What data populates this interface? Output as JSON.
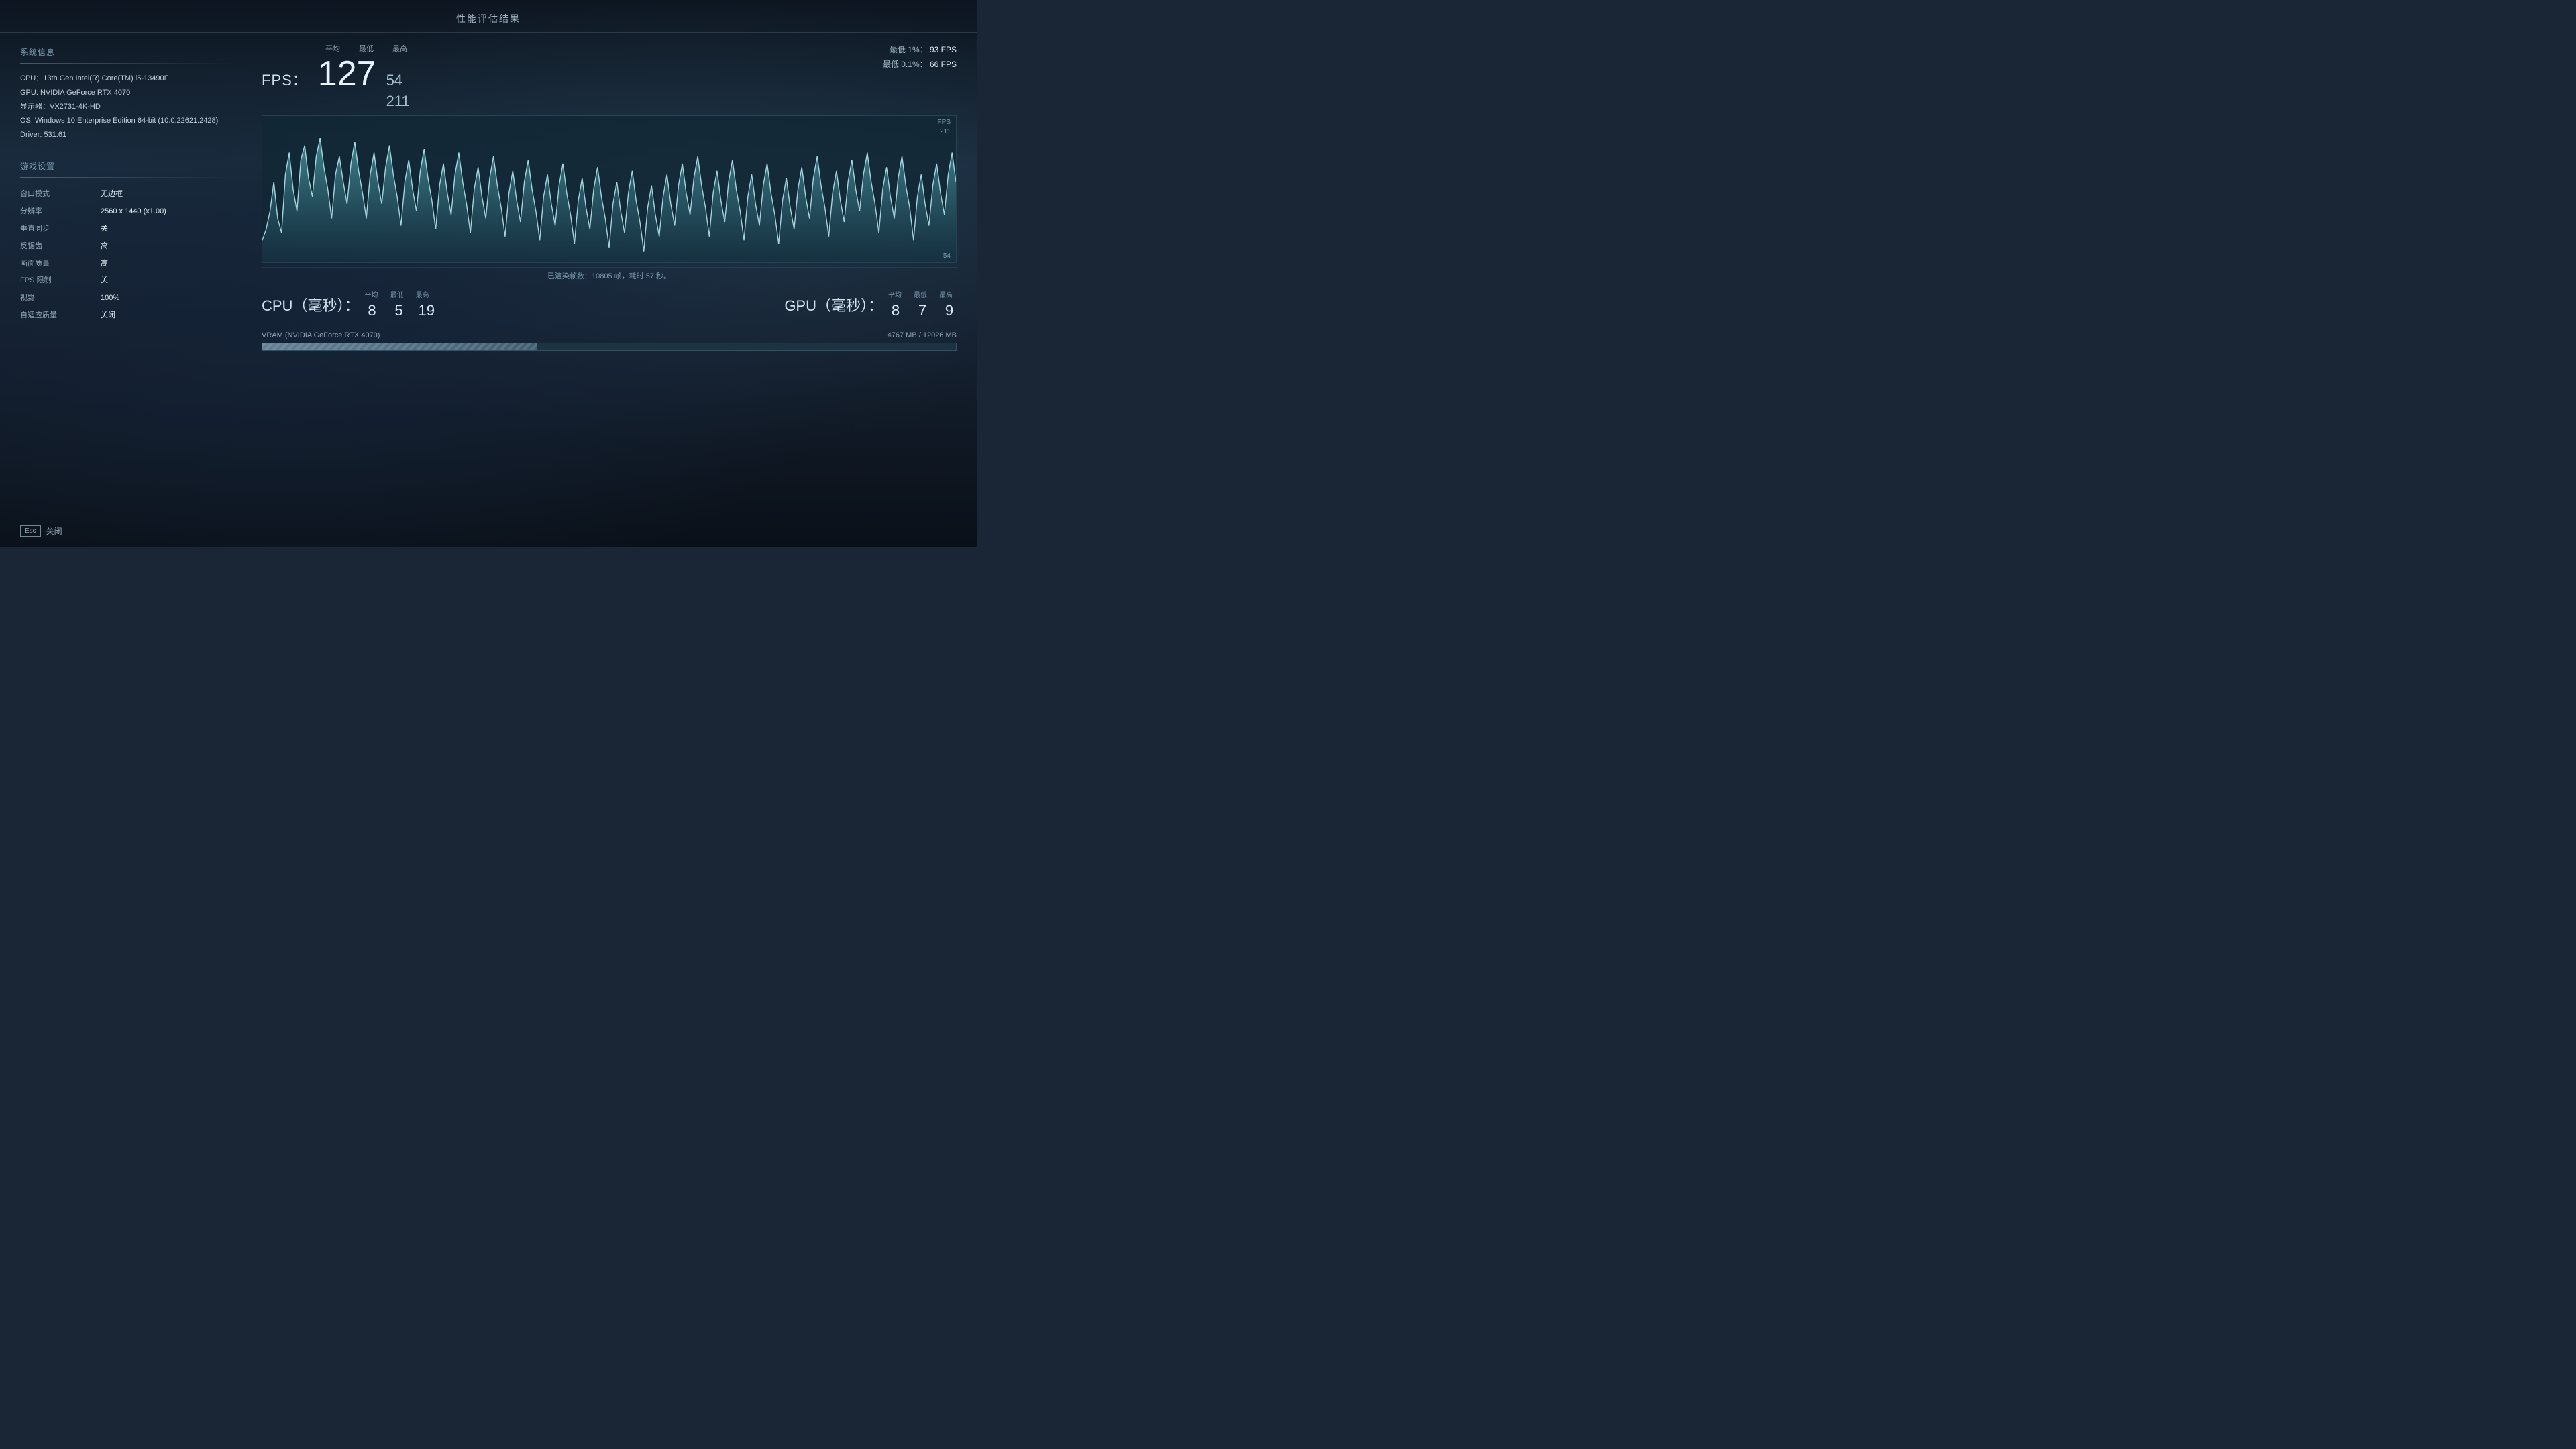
{
  "header": {
    "title": "性能评估结果"
  },
  "system_info": {
    "section_title": "系统信息",
    "cpu": "CPU：13th Gen Intel(R) Core(TM) i5-13490F",
    "gpu": "GPU: NVIDIA GeForce RTX 4070",
    "display": "显示器：VX2731-4K-HD",
    "os": "OS: Windows 10 Enterprise Edition 64-bit (10.0.22621.2428)",
    "driver": "Driver: 531.61"
  },
  "game_settings": {
    "section_title": "游戏设置",
    "rows": [
      {
        "label": "窗口模式",
        "value": "无边框"
      },
      {
        "label": "分辨率",
        "value": "2560 x 1440 (x1.00)"
      },
      {
        "label": "垂直同步",
        "value": "关"
      },
      {
        "label": "反锯齿",
        "value": "高"
      },
      {
        "label": "画面质量",
        "value": "高"
      },
      {
        "label": "FPS 限制",
        "value": "关"
      },
      {
        "label": "视野",
        "value": "100%"
      },
      {
        "label": "自适应质量",
        "value": "关闭"
      }
    ]
  },
  "fps": {
    "label": "FPS：",
    "avg_label": "平均",
    "min_label": "最低",
    "max_label": "最高",
    "avg": "127",
    "min": "54",
    "max": "211",
    "percentile_1_label": "最低 1%：",
    "percentile_1_val": "93 FPS",
    "percentile_01_label": "最低 0.1%：",
    "percentile_01_val": "66 FPS"
  },
  "chart": {
    "fps_label": "FPS",
    "max_val": "211",
    "min_val": "54",
    "rendered_frames_label": "已渲染帧数：10805 帧，耗时 57 秒。"
  },
  "cpu_stat": {
    "label": "CPU（毫秒）：",
    "avg_label": "平均",
    "min_label": "最低",
    "max_label": "最高",
    "avg": "8",
    "min": "5",
    "max": "19"
  },
  "gpu_stat": {
    "label": "GPU（毫秒）：",
    "avg_label": "平均",
    "min_label": "最低",
    "max_label": "最高",
    "avg": "8",
    "min": "7",
    "max": "9"
  },
  "vram": {
    "label": "VRAM (NVIDIA GeForce RTX 4070)",
    "used": "4767 MB",
    "total": "12026 MB",
    "percent": 39.6
  },
  "footer": {
    "esc_label": "Esc",
    "close_label": "关闭"
  }
}
